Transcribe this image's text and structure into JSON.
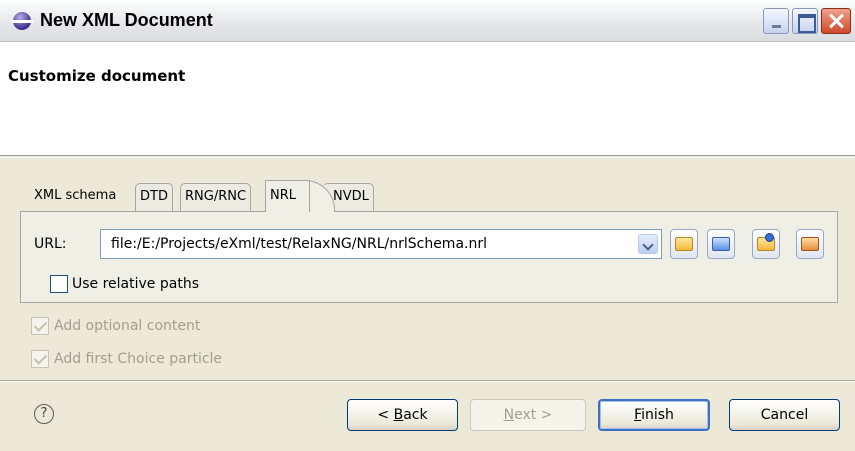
{
  "window": {
    "title": "New XML Document"
  },
  "banner": {
    "title": "Customize document"
  },
  "tabs": [
    {
      "label": "XML schema"
    },
    {
      "label": "DTD"
    },
    {
      "label": "RNG/RNC"
    },
    {
      "label": "NRL"
    },
    {
      "label": "NVDL"
    }
  ],
  "active_tab": "NRL",
  "url": {
    "label": "URL:",
    "value": "file:/E:/Projects/eXml/test/RelaxNG/NRL/nrlSchema.nrl"
  },
  "icons": {
    "open_file": "folder-open-icon",
    "browse": "folder-browse-icon",
    "open_url": "open-url-icon",
    "archive": "archive-icon"
  },
  "options": {
    "use_relative_paths": {
      "label": "Use relative paths",
      "checked": false
    },
    "add_optional_content": {
      "label": "Add optional content",
      "checked": true,
      "enabled": false
    },
    "add_first_choice": {
      "label": "Add first Choice particle",
      "checked": true,
      "enabled": false
    }
  },
  "buttons": {
    "back_pre": "< ",
    "back_mn": "B",
    "back_post": "ack",
    "next_mn": "N",
    "next_post": "ext >",
    "finish_mn": "F",
    "finish_post": "inish",
    "cancel": "Cancel"
  },
  "help": "?"
}
